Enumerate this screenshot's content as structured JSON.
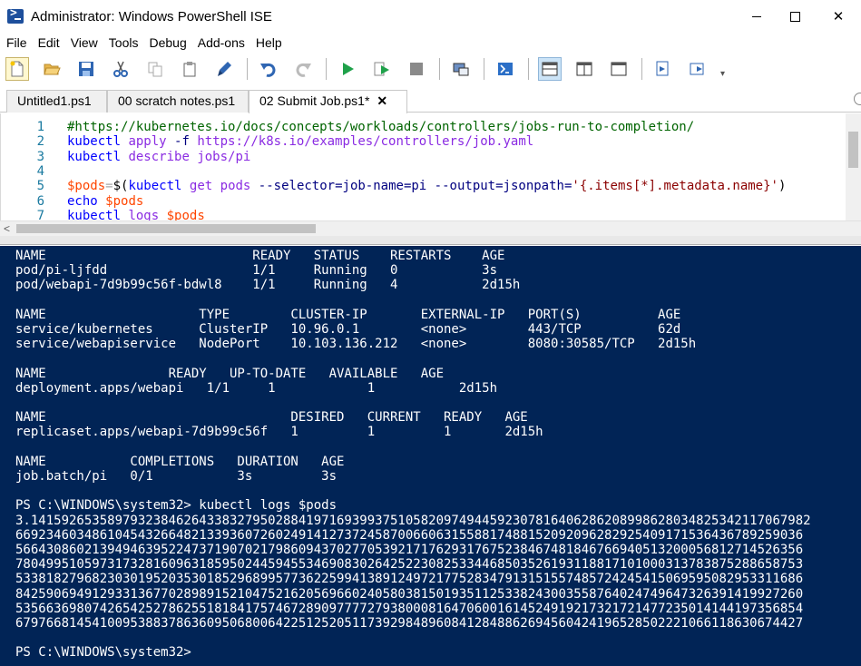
{
  "window": {
    "title": "Administrator: Windows PowerShell ISE",
    "minimize_label": "—",
    "maximize_label": "□",
    "close_label": "✕"
  },
  "menu": {
    "items": [
      "File",
      "Edit",
      "View",
      "Tools",
      "Debug",
      "Add-ons",
      "Help"
    ]
  },
  "toolbar": {
    "buttons": [
      "new-script",
      "open",
      "save",
      "cut",
      "copy",
      "paste",
      "clear-console",
      "undo",
      "redo",
      "run-script",
      "run-selection",
      "stop",
      "new-remote-tab",
      "start-powershell",
      "show-script-top",
      "show-script-right",
      "show-script-max",
      "show-command-window",
      "show-command-addon"
    ]
  },
  "tabs": [
    {
      "label": "Untitled1.ps1",
      "active": false
    },
    {
      "label": "00 scratch notes.ps1",
      "active": false
    },
    {
      "label": "02 Submit Job.ps1*",
      "active": true
    }
  ],
  "editor": {
    "lines": [
      {
        "n": "1",
        "parts": [
          [
            "c-comment",
            "#https://kubernetes.io/docs/concepts/workloads/controllers/jobs-run-to-completion/"
          ]
        ]
      },
      {
        "n": "2",
        "parts": [
          [
            "c-cmd",
            "kubectl"
          ],
          [
            "c-plain",
            " "
          ],
          [
            "c-arg",
            "apply"
          ],
          [
            "c-plain",
            " "
          ],
          [
            "c-param",
            "-f"
          ],
          [
            "c-plain",
            " "
          ],
          [
            "c-arg",
            "https://k8s.io/examples/controllers/job.yaml"
          ]
        ]
      },
      {
        "n": "3",
        "parts": [
          [
            "c-cmd",
            "kubectl"
          ],
          [
            "c-plain",
            " "
          ],
          [
            "c-arg",
            "describe"
          ],
          [
            "c-plain",
            " "
          ],
          [
            "c-arg",
            "jobs/pi"
          ]
        ]
      },
      {
        "n": "4",
        "parts": []
      },
      {
        "n": "5",
        "parts": [
          [
            "c-var",
            "$pods"
          ],
          [
            "c-op",
            "="
          ],
          [
            "c-plain",
            "$("
          ],
          [
            "c-cmd",
            "kubectl"
          ],
          [
            "c-plain",
            " "
          ],
          [
            "c-arg",
            "get"
          ],
          [
            "c-plain",
            " "
          ],
          [
            "c-arg",
            "pods"
          ],
          [
            "c-plain",
            " "
          ],
          [
            "c-param",
            "--selector=job-name=pi"
          ],
          [
            "c-plain",
            " "
          ],
          [
            "c-param",
            "--output=jsonpath="
          ],
          [
            "c-str",
            "'{.items[*].metadata.name}'"
          ],
          [
            "c-plain",
            ")"
          ]
        ]
      },
      {
        "n": "6",
        "parts": [
          [
            "c-cmd",
            "echo"
          ],
          [
            "c-plain",
            " "
          ],
          [
            "c-var",
            "$pods"
          ]
        ]
      },
      {
        "n": "7",
        "parts": [
          [
            "c-cmd",
            "kubectl"
          ],
          [
            "c-plain",
            " "
          ],
          [
            "c-arg",
            "logs"
          ],
          [
            "c-plain",
            " "
          ],
          [
            "c-var",
            "$pods"
          ]
        ]
      }
    ]
  },
  "console": {
    "lines": [
      "NAME                           READY   STATUS    RESTARTS    AGE",
      "pod/pi-ljfdd                   1/1     Running   0           3s",
      "pod/webapi-7d9b99c56f-bdwl8    1/1     Running   4           2d15h",
      "",
      "NAME                    TYPE        CLUSTER-IP       EXTERNAL-IP   PORT(S)          AGE",
      "service/kubernetes      ClusterIP   10.96.0.1        <none>        443/TCP          62d",
      "service/webapiservice   NodePort    10.103.136.212   <none>        8080:30585/TCP   2d15h",
      "",
      "NAME                READY   UP-TO-DATE   AVAILABLE   AGE",
      "deployment.apps/webapi   1/1     1            1           2d15h",
      "",
      "NAME                                DESIRED   CURRENT   READY   AGE",
      "replicaset.apps/webapi-7d9b99c56f   1         1         1       2d15h",
      "",
      "NAME           COMPLETIONS   DURATION   AGE",
      "job.batch/pi   0/1           3s         3s",
      "",
      "PS C:\\WINDOWS\\system32> kubectl logs $pods",
      "3.141592653589793238462643383279502884197169399375105820974944592307816406286208998628034825342117067982",
      "6692346034861045432664821339360726024914127372458700660631558817488152092096282925409171536436789259036",
      "5664308602139494639522473719070217986094370277053921717629317675238467481846766940513200056812714526356",
      "7804995105973173281609631859502445945534690830264252230825334468503526193118817101000313783875288658753",
      "5338182796823030195203530185296899577362259941389124972177528347913151557485724245415069595082953311686",
      "8425906949129331367702898915210475216205696602405803815019351125338243003558764024749647326391419927260",
      "5356636980742654252786255181841757467289097777279380008164706001614524919217321721477235014144197356854",
      "6797668145410095388378636095068006422512520511739298489608412848862694560424196528502221066118630674427",
      "",
      "PS C:\\WINDOWS\\system32>"
    ]
  }
}
